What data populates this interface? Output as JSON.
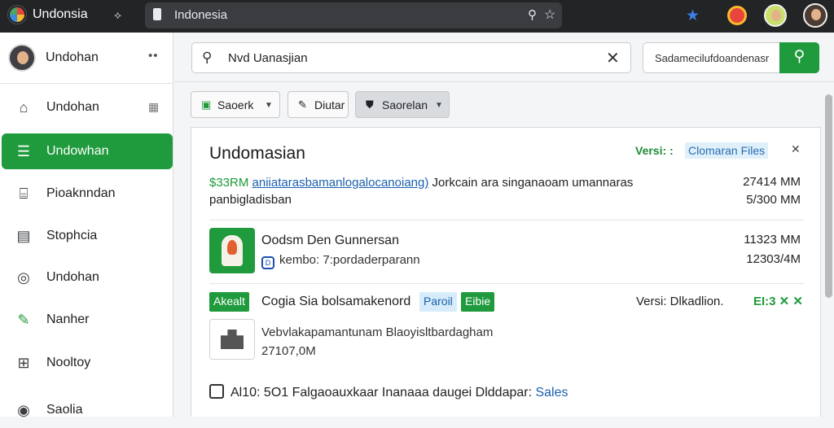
{
  "app": {
    "title": "Undonsia",
    "tab_icon": "pin-icon"
  },
  "urlbar": {
    "text": "Indonesia"
  },
  "sidebar": {
    "profile_name": "Undohan",
    "more": "••",
    "items": [
      {
        "label": "Undohan",
        "icon": "home-icon",
        "badge": "▦"
      },
      {
        "label": "Undowhan",
        "icon": "list-icon",
        "active": true
      },
      {
        "label": "Pioaknndan",
        "icon": "bank-icon"
      },
      {
        "label": "Stophcia",
        "icon": "document-icon"
      },
      {
        "label": "Undohan",
        "icon": "search-icon"
      },
      {
        "label": "Nanher",
        "icon": "tool-icon"
      },
      {
        "label": "Nooltoy",
        "icon": "grid-icon"
      },
      {
        "label": "Saolia",
        "icon": "circle-icon"
      }
    ]
  },
  "search": {
    "value": "Nvd Uanasjian",
    "filter_text": "Sadamecilufdoandenasr"
  },
  "toolbar": {
    "btn1": "Saoerk",
    "btn2": "Diutar",
    "btn3": "Saorelan"
  },
  "panel": {
    "title": "Undomasian",
    "version_label": "Versi:  :",
    "version_link": "Clomaran Files",
    "close": "✕",
    "summary_amount": "$33RM",
    "summary_link": "aniiatarasbamanlogalocanoiang)",
    "summary_desc": " Jorkcain ara singanaoam umannaras",
    "summary_sub": "panbigladisban",
    "summary_val1": "27414 MM",
    "summary_val2": "5/300 MM",
    "item_title": "Oodsm Den Gunnersan",
    "item_meta": "kembo: 7:pordaderparann",
    "item_val1": "11323 MM",
    "item_val2": "12303/4M",
    "tag1": "Akealt",
    "tag2_title": "Cogia Sia bolsamakenord",
    "tag3": "Paroil",
    "tag4": "Eibie",
    "tag2_version": "Versi: Dlkadlion.",
    "tag2_flags": "EI:3 ✕ ✕",
    "doc_text": "Vebvlakapamantunam Blaoyisltbardagham",
    "doc_value": "27107,0M",
    "footer_prefix": "Al10: 5O1",
    "footer_text": " Falgaoauxkaar Inanaaa daugei Dlddapar: ",
    "footer_link": "Sales"
  }
}
